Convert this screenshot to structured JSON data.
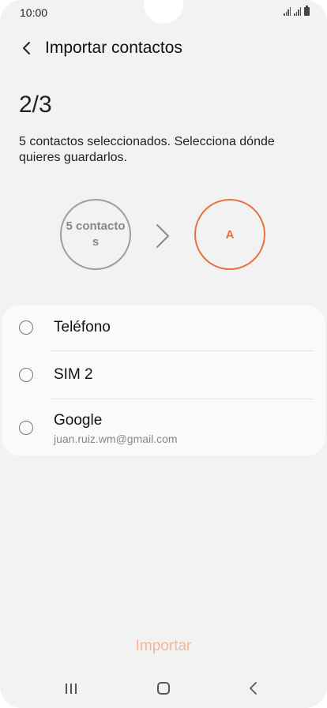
{
  "status_bar": {
    "time": "10:00"
  },
  "header": {
    "title": "Importar contactos"
  },
  "step": "2/3",
  "description": "5 contactos seleccionados. Selecciona dónde quieres guardarlos.",
  "diagram": {
    "source_label": "5 contactos",
    "target_label": "A"
  },
  "storage_options": [
    {
      "label": "Teléfono"
    },
    {
      "label": "SIM 2"
    },
    {
      "label": "Google",
      "sublabel": "juan.ruiz.wm@gmail.com"
    }
  ],
  "import_button": "Importar",
  "colors": {
    "accent": "#e8733a",
    "disabled_accent": "#f0b79b",
    "background": "#f2f2f2",
    "card": "#fafafa"
  }
}
